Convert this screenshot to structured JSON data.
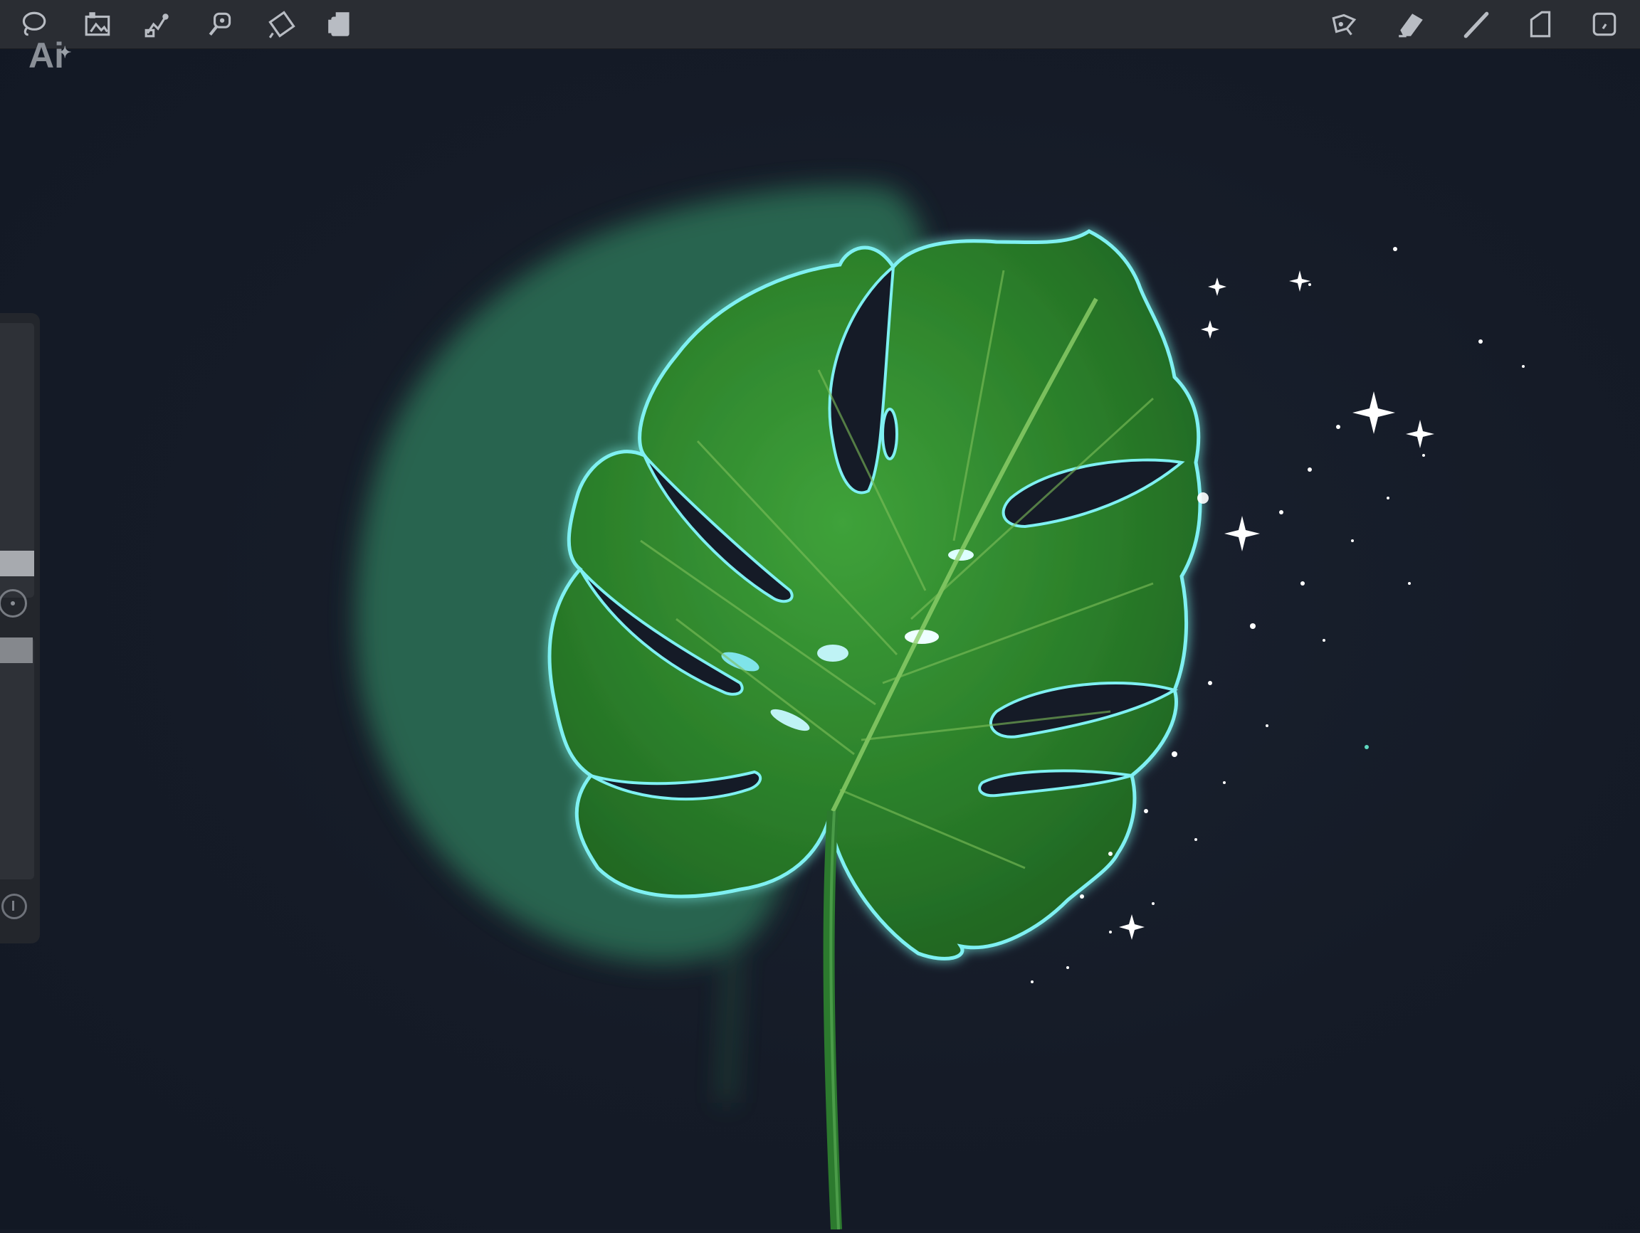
{
  "app": {
    "badge_text": "Ai",
    "badge_spark": "✦"
  },
  "toolbar_left": [
    {
      "name": "selection-icon"
    },
    {
      "name": "gallery-icon"
    },
    {
      "name": "adjustments-icon"
    },
    {
      "name": "transform-icon"
    },
    {
      "name": "actions-icon"
    },
    {
      "name": "layers-icon"
    }
  ],
  "toolbar_right": [
    {
      "name": "smudge-icon"
    },
    {
      "name": "eraser-icon"
    },
    {
      "name": "brush-icon"
    },
    {
      "name": "layers-panel-icon"
    },
    {
      "name": "color-swatch-icon"
    }
  ],
  "canvas": {
    "background": "#151b27",
    "leaf_color": "#2f8a2e",
    "glow_color": "#56e3e9",
    "sparkle_color": "#ffffff"
  }
}
